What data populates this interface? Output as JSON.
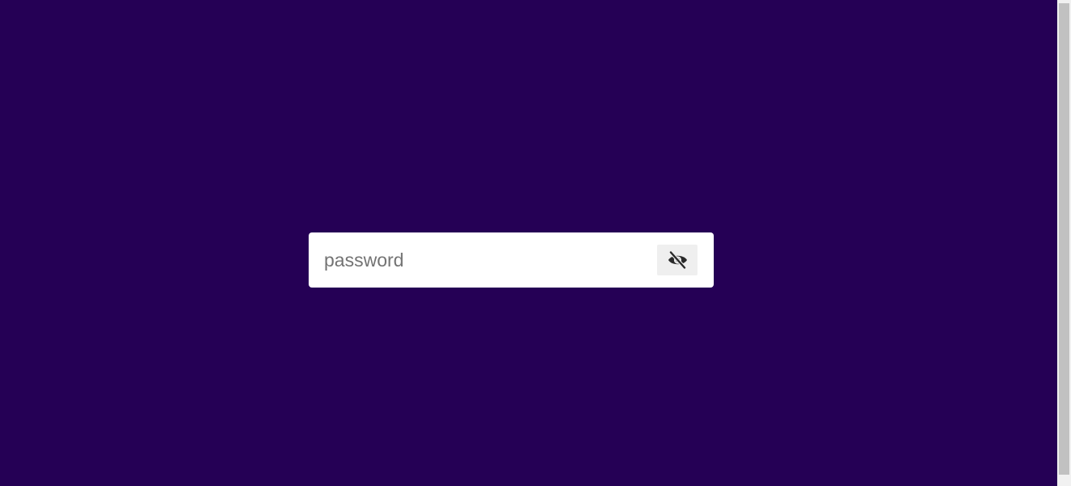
{
  "theme": {
    "background": "#250055",
    "field_background": "#ffffff",
    "button_background": "#efefef",
    "icon_color": "#2a2a2a",
    "placeholder_color": "#737373"
  },
  "password_field": {
    "placeholder": "password",
    "value": "",
    "type": "password"
  },
  "visibility_toggle": {
    "icon": "eye-slash-icon",
    "state": "hidden"
  }
}
